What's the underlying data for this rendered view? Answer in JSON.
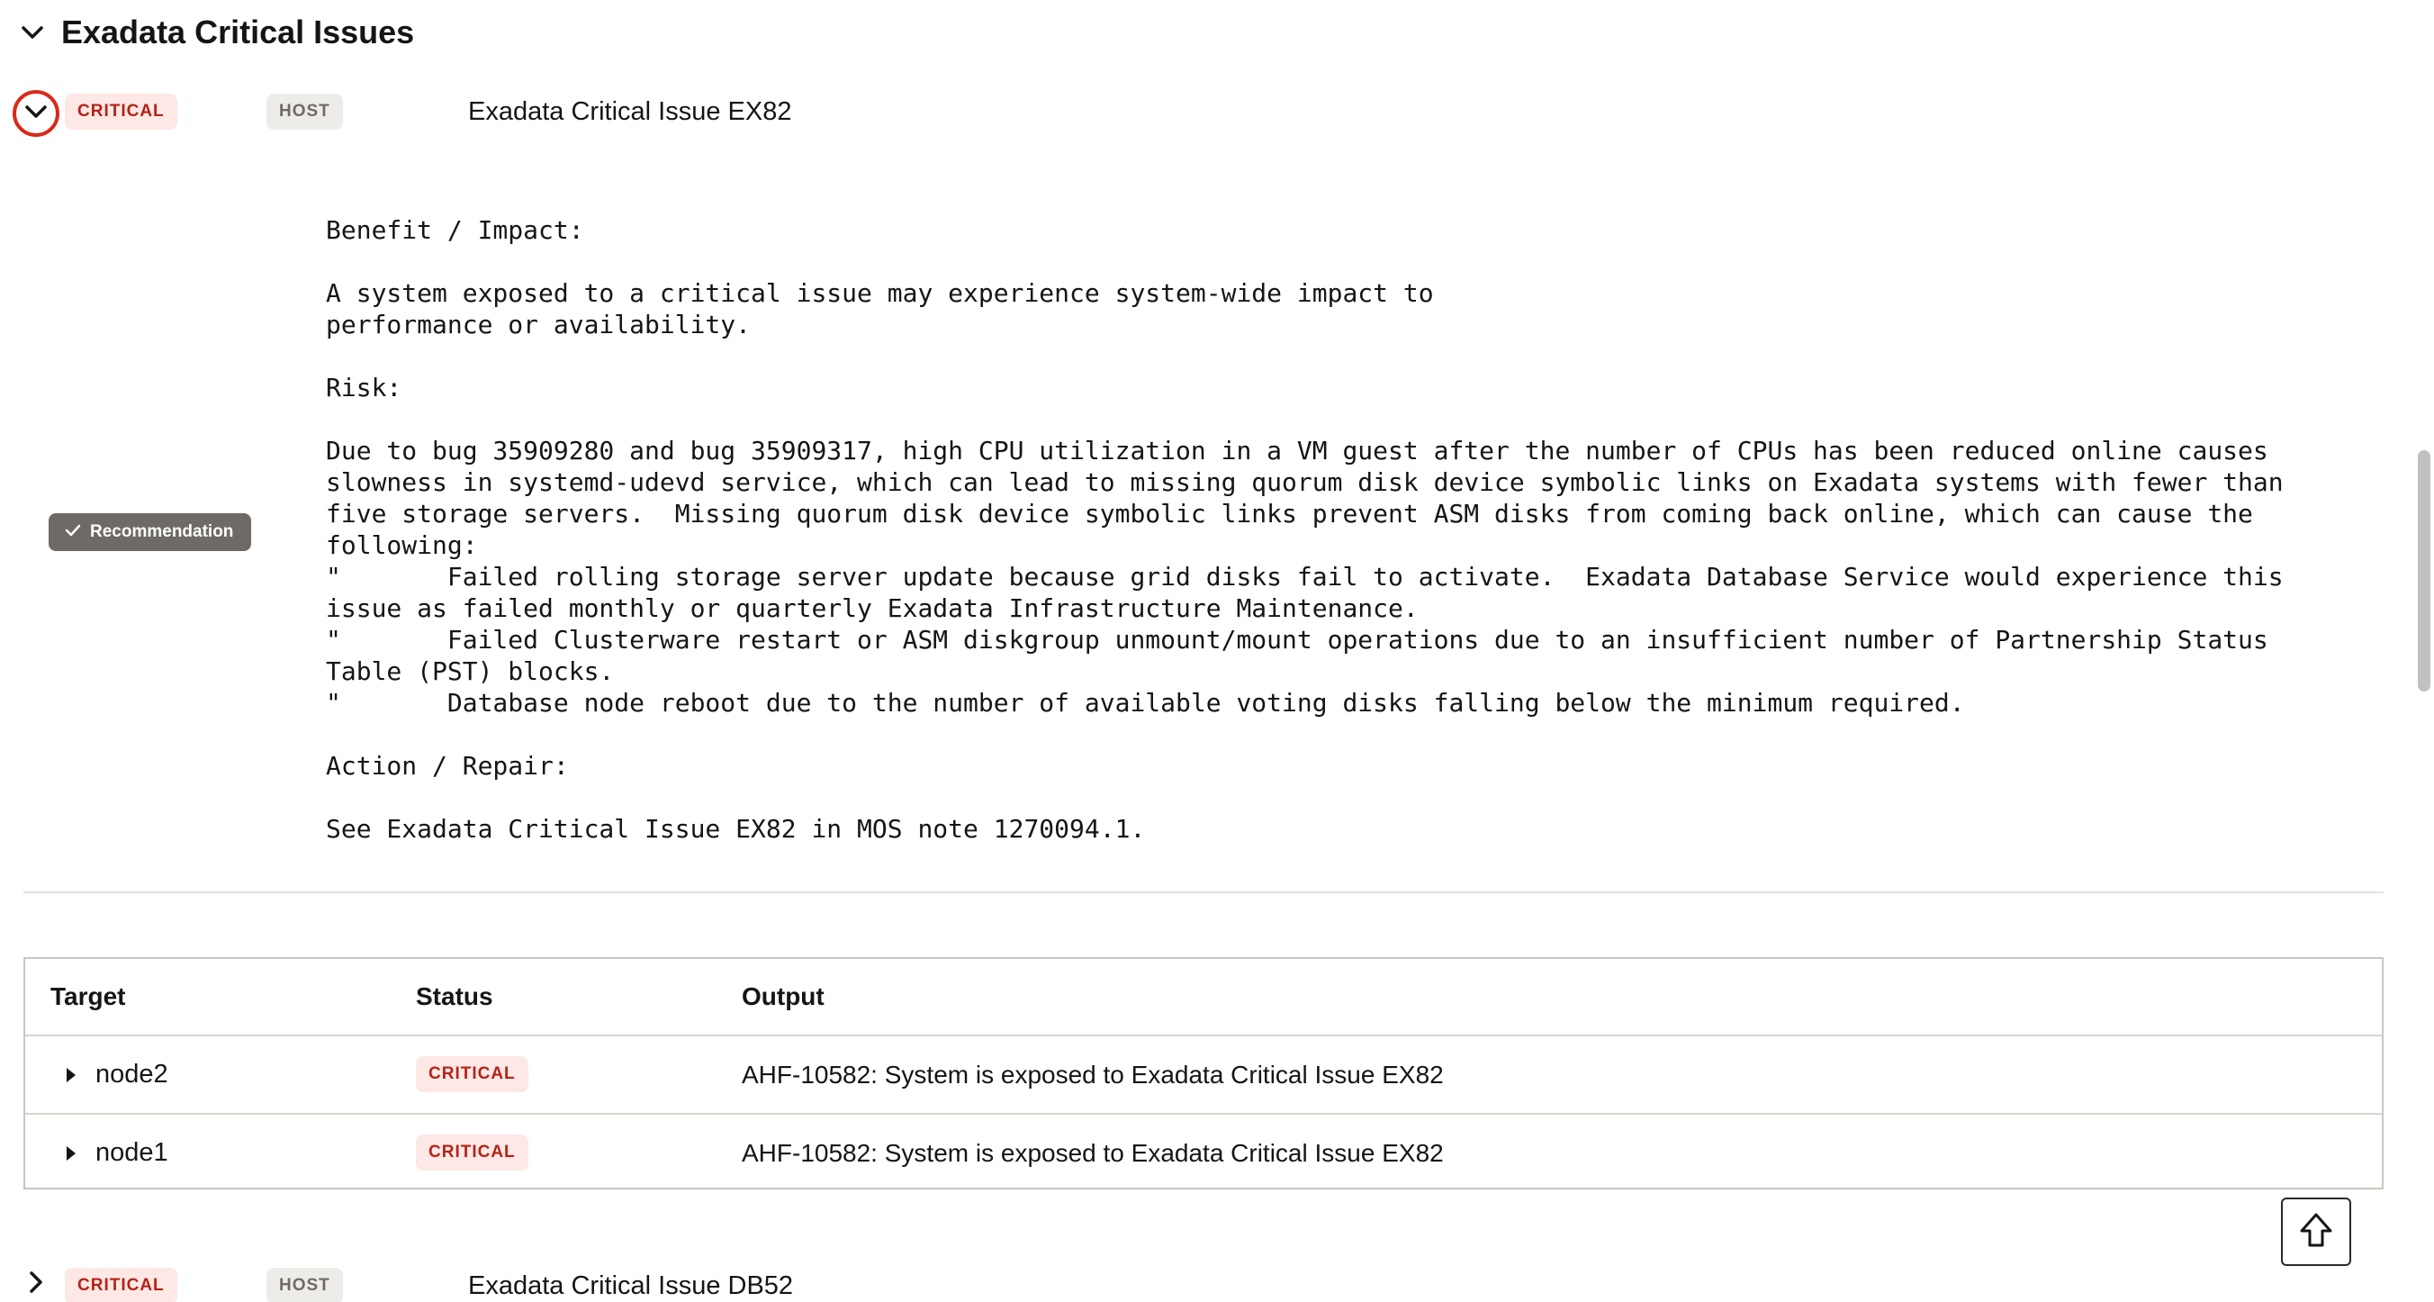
{
  "section": {
    "title": "Exadata Critical Issues"
  },
  "issues": [
    {
      "severity": "CRITICAL",
      "scope": "HOST",
      "title": "Exadata Critical Issue EX82"
    },
    {
      "severity": "CRITICAL",
      "scope": "HOST",
      "title": "Exadata Critical Issue DB52"
    }
  ],
  "detail": {
    "badge_label": "Recommendation",
    "text": "Benefit / Impact:\n\nA system exposed to a critical issue may experience system-wide impact to\nperformance or availability.\n\nRisk:\n\nDue to bug 35909280 and bug 35909317, high CPU utilization in a VM guest after the number of CPUs has been reduced online causes\nslowness in systemd-udevd service, which can lead to missing quorum disk device symbolic links on Exadata systems with fewer than\nfive storage servers.  Missing quorum disk device symbolic links prevent ASM disks from coming back online, which can cause the\nfollowing:\n\"       Failed rolling storage server update because grid disks fail to activate.  Exadata Database Service would experience this\nissue as failed monthly or quarterly Exadata Infrastructure Maintenance.\n\"       Failed Clusterware restart or ASM diskgroup unmount/mount operations due to an insufficient number of Partnership Status\nTable (PST) blocks.\n\"       Database node reboot due to the number of available voting disks falling below the minimum required.\n\nAction / Repair:\n\nSee Exadata Critical Issue EX82 in MOS note 1270094.1."
  },
  "table": {
    "headers": {
      "target": "Target",
      "status": "Status",
      "output": "Output"
    },
    "rows": [
      {
        "target": "node2",
        "status": "CRITICAL",
        "output": "AHF-10582: System is exposed to Exadata Critical Issue EX82"
      },
      {
        "target": "node1",
        "status": "CRITICAL",
        "output": "AHF-10582: System is exposed to Exadata Critical Issue EX82"
      }
    ]
  },
  "colors": {
    "critical_text": "#b42318",
    "critical_bg": "#fde8e6",
    "host_text": "#6f6a65",
    "host_bg": "#eeece9",
    "focus_ring": "#d92a1c",
    "recommendation_bg": "#6f6a65"
  },
  "icons": {
    "section_toggle": "chevron-down-icon",
    "issue_expanded": "chevron-down-icon",
    "issue_collapsed": "chevron-right-icon",
    "row_expand": "caret-right-icon",
    "recommendation": "check-icon",
    "scroll_top": "arrow-up-icon"
  }
}
